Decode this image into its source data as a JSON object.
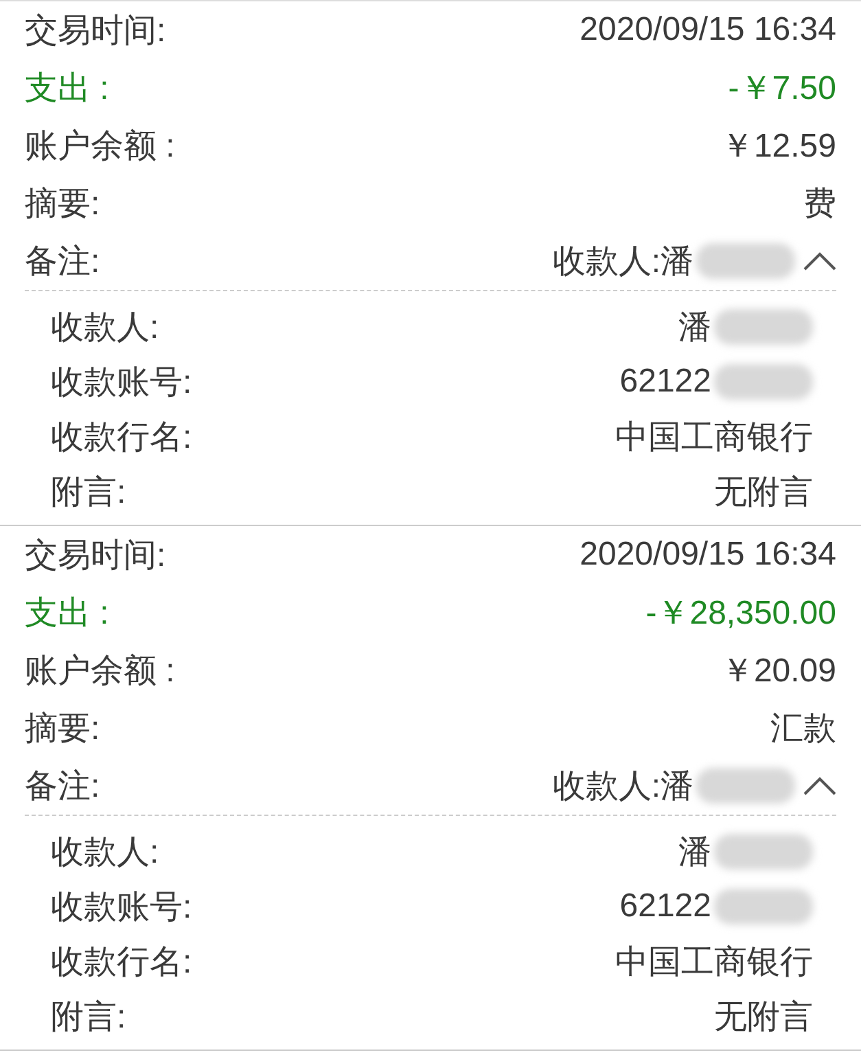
{
  "records": [
    {
      "main": [
        {
          "kind": "plain",
          "label": "交易时间:",
          "value": "2020/09/15 16:34"
        },
        {
          "kind": "expense",
          "label": "支出 :",
          "value": "-￥7.50"
        },
        {
          "kind": "plain",
          "label": "账户余额 :",
          "value": "￥12.59"
        },
        {
          "kind": "plain",
          "label": "摘要:",
          "value": "费"
        },
        {
          "kind": "remark",
          "label": "备注:",
          "value": "收款人:潘",
          "blurred": true
        }
      ],
      "expanded": true,
      "details": [
        {
          "label": "收款人:",
          "value": "潘",
          "blurred": true
        },
        {
          "label": "收款账号:",
          "value": "62122",
          "blurred": true
        },
        {
          "label": "收款行名:",
          "value": "中国工商银行",
          "blurred": false
        },
        {
          "label": "附言:",
          "value": "无附言",
          "blurred": false
        }
      ]
    },
    {
      "main": [
        {
          "kind": "plain",
          "label": "交易时间:",
          "value": "2020/09/15 16:34"
        },
        {
          "kind": "expense",
          "label": "支出 :",
          "value": "-￥28,350.00"
        },
        {
          "kind": "plain",
          "label": "账户余额 :",
          "value": "￥20.09"
        },
        {
          "kind": "plain",
          "label": "摘要:",
          "value": "汇款"
        },
        {
          "kind": "remark",
          "label": "备注:",
          "value": "收款人:潘",
          "blurred": true
        }
      ],
      "expanded": true,
      "details": [
        {
          "label": "收款人:",
          "value": "潘",
          "blurred": true
        },
        {
          "label": "收款账号:",
          "value": "62122",
          "blurred": true
        },
        {
          "label": "收款行名:",
          "value": "中国工商银行",
          "blurred": false
        },
        {
          "label": "附言:",
          "value": "无附言",
          "blurred": false
        }
      ]
    }
  ]
}
